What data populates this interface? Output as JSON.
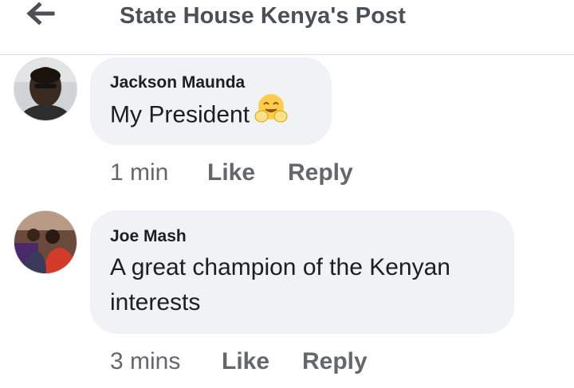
{
  "header": {
    "title": "State House Kenya's Post",
    "back_icon": "arrow-left-icon"
  },
  "comments": [
    {
      "author": "Jackson Maunda",
      "text": "My President",
      "emoji_icon": "hugging-face-emoji-icon",
      "time": "1 min",
      "like_label": "Like",
      "reply_label": "Reply"
    },
    {
      "author": "Joe Mash",
      "text_line1": "A great champion of the Kenyan",
      "text_line2": "interests",
      "time": "3 mins",
      "like_label": "Like",
      "reply_label": "Reply"
    }
  ],
  "colors": {
    "bubble": "#f0f2f5",
    "text": "#1c1e21",
    "secondary": "#65676b",
    "header_text": "#4b4f56"
  }
}
